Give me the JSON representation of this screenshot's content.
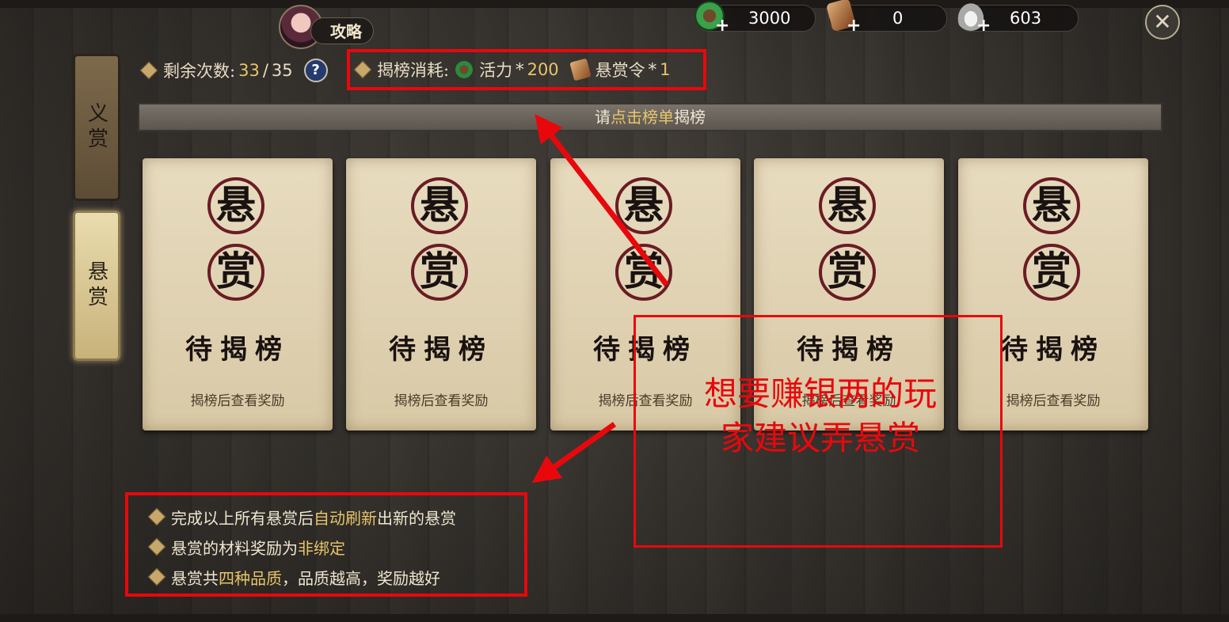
{
  "header": {
    "guide_label": "攻略",
    "currencies": [
      {
        "name": "jade",
        "icon": "jade-coin-icon",
        "value": "3000"
      },
      {
        "name": "bounty-token",
        "icon": "bounty-token-icon",
        "value": "0"
      },
      {
        "name": "silver",
        "icon": "silver-ingot-icon",
        "value": "603"
      }
    ]
  },
  "tabs": [
    {
      "label": "义赏",
      "active": false
    },
    {
      "label": "悬赏",
      "active": true
    }
  ],
  "remaining": {
    "label": "剩余次数:",
    "used": "33",
    "sep": "/",
    "total": "35",
    "help": "?"
  },
  "cost": {
    "label": "揭榜消耗:",
    "item1": "活力",
    "mult1": "*",
    "amount1": "200",
    "item2": "悬赏令",
    "mult2": "*",
    "amount2": "1"
  },
  "banner": {
    "pre": "请",
    "highlight": "点击榜单",
    "post": "揭榜"
  },
  "cards": [
    {
      "seal_top": "悬",
      "seal_bottom": "赏",
      "state": "待揭榜",
      "hint": "揭榜后查看奖励"
    },
    {
      "seal_top": "悬",
      "seal_bottom": "赏",
      "state": "待揭榜",
      "hint": "揭榜后查看奖励"
    },
    {
      "seal_top": "悬",
      "seal_bottom": "赏",
      "state": "待揭榜",
      "hint": "揭榜后查看奖励"
    },
    {
      "seal_top": "悬",
      "seal_bottom": "赏",
      "state": "待揭榜",
      "hint": "揭榜后查看奖励"
    },
    {
      "seal_top": "悬",
      "seal_bottom": "赏",
      "state": "待揭榜",
      "hint": "揭榜后查看奖励"
    }
  ],
  "annotation": {
    "line1": "想要赚银两的玩",
    "line2": "家建议弄悬赏"
  },
  "rules": [
    {
      "pre": "完成以上所有悬赏后",
      "highlight": "自动刷新",
      "post": "出新的悬赏"
    },
    {
      "pre": "悬赏的材料奖励为",
      "highlight": "非绑定",
      "post": ""
    },
    {
      "pre": "悬赏共",
      "highlight": "四种品质",
      "post": "，品质越高，奖励越好"
    }
  ],
  "colors": {
    "annotation_red": "#e8080c",
    "highlight_gold": "#e6c56a"
  }
}
